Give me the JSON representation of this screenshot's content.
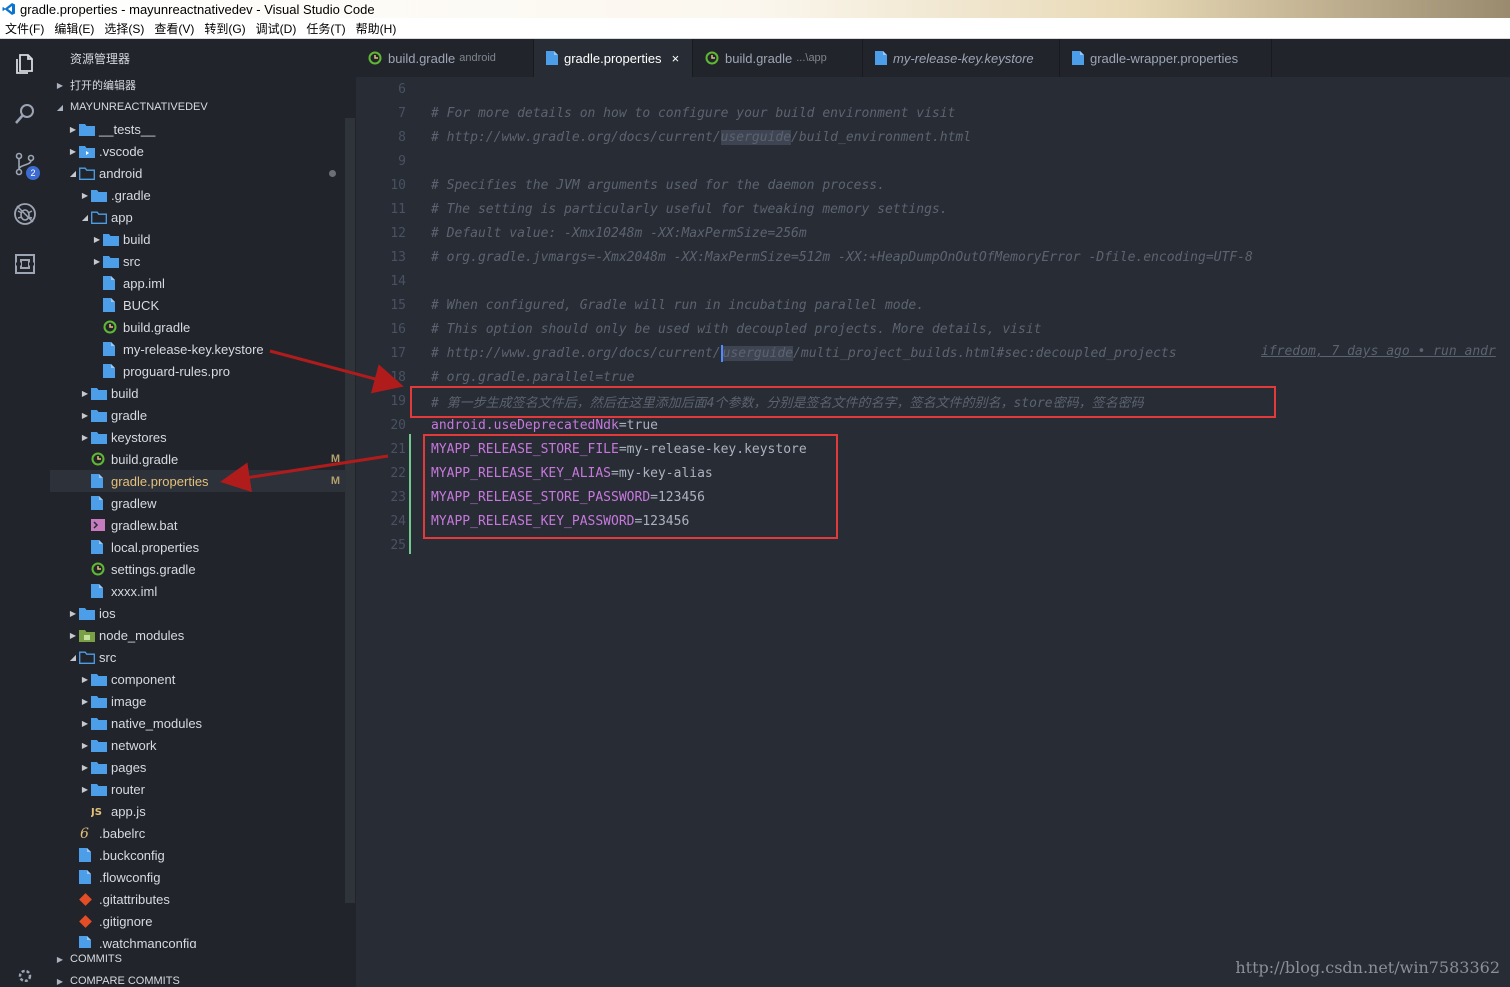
{
  "window": {
    "title": "gradle.properties - mayunreactnativedev - Visual Studio Code"
  },
  "menu": [
    "文件(F)",
    "编辑(E)",
    "选择(S)",
    "查看(V)",
    "转到(G)",
    "调试(D)",
    "任务(T)",
    "帮助(H)"
  ],
  "activity": {
    "scm_badge": "2"
  },
  "sidebar": {
    "title": "资源管理器",
    "open_editors": "打开的编辑器",
    "project": "MAYUNREACTNATIVEDEV",
    "commits": "COMMITS",
    "compare": "COMPARE COMMITS"
  },
  "tree": [
    {
      "label": "__tests__",
      "depth": 0,
      "type": "folder",
      "open": false
    },
    {
      "label": ".vscode",
      "depth": 0,
      "type": "folder-vscode",
      "open": false
    },
    {
      "label": "android",
      "depth": 0,
      "type": "folder-open",
      "open": true,
      "dot": true
    },
    {
      "label": ".gradle",
      "depth": 1,
      "type": "folder",
      "open": false
    },
    {
      "label": "app",
      "depth": 1,
      "type": "folder-open",
      "open": true
    },
    {
      "label": "build",
      "depth": 2,
      "type": "folder",
      "open": false
    },
    {
      "label": "src",
      "depth": 2,
      "type": "folder",
      "open": false
    },
    {
      "label": "app.iml",
      "depth": 2,
      "type": "file"
    },
    {
      "label": "BUCK",
      "depth": 2,
      "type": "file"
    },
    {
      "label": "build.gradle",
      "depth": 2,
      "type": "gradle"
    },
    {
      "label": "my-release-key.keystore",
      "depth": 2,
      "type": "file"
    },
    {
      "label": "proguard-rules.pro",
      "depth": 2,
      "type": "file"
    },
    {
      "label": "build",
      "depth": 1,
      "type": "folder",
      "open": false
    },
    {
      "label": "gradle",
      "depth": 1,
      "type": "folder",
      "open": false
    },
    {
      "label": "keystores",
      "depth": 1,
      "type": "folder",
      "open": false
    },
    {
      "label": "build.gradle",
      "depth": 1,
      "type": "gradle",
      "git": "M"
    },
    {
      "label": "gradle.properties",
      "depth": 1,
      "type": "file",
      "git": "M",
      "selected": true
    },
    {
      "label": "gradlew",
      "depth": 1,
      "type": "file"
    },
    {
      "label": "gradlew.bat",
      "depth": 1,
      "type": "terminal"
    },
    {
      "label": "local.properties",
      "depth": 1,
      "type": "file"
    },
    {
      "label": "settings.gradle",
      "depth": 1,
      "type": "gradle"
    },
    {
      "label": "xxxx.iml",
      "depth": 1,
      "type": "file"
    },
    {
      "label": "ios",
      "depth": 0,
      "type": "folder",
      "open": false
    },
    {
      "label": "node_modules",
      "depth": 0,
      "type": "folder-node",
      "open": false
    },
    {
      "label": "src",
      "depth": 0,
      "type": "folder-open",
      "open": true
    },
    {
      "label": "component",
      "depth": 1,
      "type": "folder",
      "open": false
    },
    {
      "label": "image",
      "depth": 1,
      "type": "folder",
      "open": false
    },
    {
      "label": "native_modules",
      "depth": 1,
      "type": "folder",
      "open": false
    },
    {
      "label": "network",
      "depth": 1,
      "type": "folder",
      "open": false
    },
    {
      "label": "pages",
      "depth": 1,
      "type": "folder",
      "open": false
    },
    {
      "label": "router",
      "depth": 1,
      "type": "folder",
      "open": false
    },
    {
      "label": "app.js",
      "depth": 1,
      "type": "js"
    },
    {
      "label": ".babelrc",
      "depth": 0,
      "type": "babel"
    },
    {
      "label": ".buckconfig",
      "depth": 0,
      "type": "file"
    },
    {
      "label": ".flowconfig",
      "depth": 0,
      "type": "file"
    },
    {
      "label": ".gitattributes",
      "depth": 0,
      "type": "git"
    },
    {
      "label": ".gitignore",
      "depth": 0,
      "type": "git"
    },
    {
      "label": ".watchmanconfig",
      "depth": 0,
      "type": "file"
    }
  ],
  "tabs": [
    {
      "label": "build.gradle",
      "desc": "android",
      "icon": "gradle-icon"
    },
    {
      "label": "gradle.properties",
      "desc": "",
      "icon": "file-icon",
      "active": true,
      "close": "×"
    },
    {
      "label": "build.gradle",
      "desc": "...\\app",
      "icon": "gradle-icon"
    },
    {
      "label": "my-release-key.keystore",
      "desc": "",
      "icon": "file-icon",
      "italic": true
    },
    {
      "label": "gradle-wrapper.properties",
      "desc": "",
      "icon": "file-icon"
    }
  ],
  "editor": {
    "lines": [
      {
        "n": "6",
        "parts": []
      },
      {
        "n": "7",
        "parts": [
          {
            "t": "# For more details on how to configure your build environment visit",
            "c": "cmt"
          }
        ]
      },
      {
        "n": "8",
        "parts": [
          {
            "t": "# ",
            "c": "cmt"
          },
          {
            "t": "http://www.gradle.org/docs/current/",
            "c": "cmt url"
          },
          {
            "t": "userguide",
            "c": "cmt url hl"
          },
          {
            "t": "/build_environment.html",
            "c": "cmt url"
          }
        ]
      },
      {
        "n": "9",
        "parts": []
      },
      {
        "n": "10",
        "parts": [
          {
            "t": "# Specifies the JVM arguments used for the daemon process.",
            "c": "cmt"
          }
        ]
      },
      {
        "n": "11",
        "parts": [
          {
            "t": "# The setting is particularly useful for tweaking memory settings.",
            "c": "cmt"
          }
        ]
      },
      {
        "n": "12",
        "parts": [
          {
            "t": "# Default value: -Xmx10248m -XX:MaxPermSize=256m",
            "c": "cmt"
          }
        ]
      },
      {
        "n": "13",
        "parts": [
          {
            "t": "# org.gradle.jvmargs=-Xmx2048m -XX:MaxPermSize=512m -XX:+HeapDumpOnOutOfMemoryError -Dfile.encoding=UTF-8",
            "c": "cmt"
          }
        ]
      },
      {
        "n": "14",
        "parts": []
      },
      {
        "n": "15",
        "parts": [
          {
            "t": "# When configured, Gradle will run in incubating parallel mode.",
            "c": "cmt"
          }
        ]
      },
      {
        "n": "16",
        "parts": [
          {
            "t": "# This option should only be used with decoupled projects. More details, visit",
            "c": "cmt"
          }
        ]
      },
      {
        "n": "17",
        "parts": [
          {
            "t": "# ",
            "c": "cmt"
          },
          {
            "t": "http://www.gradle.org/docs/current/",
            "c": "cmt url"
          },
          {
            "t": "|",
            "c": "cursor"
          },
          {
            "t": "userguide",
            "c": "cmt url hl"
          },
          {
            "t": "/multi_project_builds.html#sec:decoupled_projects",
            "c": "cmt url"
          }
        ]
      },
      {
        "n": "18",
        "parts": [
          {
            "t": "# org.gradle.parallel=true",
            "c": "cmt"
          }
        ]
      },
      {
        "n": "19",
        "parts": [
          {
            "t": "# 第一步生成签名文件后，然后在这里添加后面4个参数，分别是签名文件的名字，签名文件的别名，store密码，签名密码",
            "c": "cmt"
          }
        ]
      },
      {
        "n": "20",
        "parts": [
          {
            "t": "android.useDeprecatedNdk",
            "c": "key-purple"
          },
          {
            "t": "=true",
            "c": "val"
          }
        ]
      },
      {
        "n": "21",
        "parts": [
          {
            "t": "MYAPP_RELEASE_STORE_FILE",
            "c": "key-purple"
          },
          {
            "t": "=my-release-key.keystore",
            "c": "val"
          }
        ]
      },
      {
        "n": "22",
        "parts": [
          {
            "t": "MYAPP_RELEASE_KEY_ALIAS",
            "c": "key-purple"
          },
          {
            "t": "=my-key-alias",
            "c": "val"
          }
        ]
      },
      {
        "n": "23",
        "parts": [
          {
            "t": "MYAPP_RELEASE_STORE_PASSWORD",
            "c": "key-purple"
          },
          {
            "t": "=123456",
            "c": "val"
          }
        ]
      },
      {
        "n": "24",
        "parts": [
          {
            "t": "MYAPP_RELEASE_KEY_PASSWORD",
            "c": "key-purple"
          },
          {
            "t": "=123456",
            "c": "val"
          }
        ]
      },
      {
        "n": "25",
        "parts": []
      }
    ],
    "blame": "ifredom, 7 days ago • run andr"
  },
  "watermark": "http://blog.csdn.net/win7583362",
  "colors": {
    "annotation": "#e2393a",
    "folder": "#4d9ee8",
    "gradle": "#5fb832",
    "file": "#4d9ee8",
    "git": "#e44d26",
    "modified": "#b1a06b"
  }
}
